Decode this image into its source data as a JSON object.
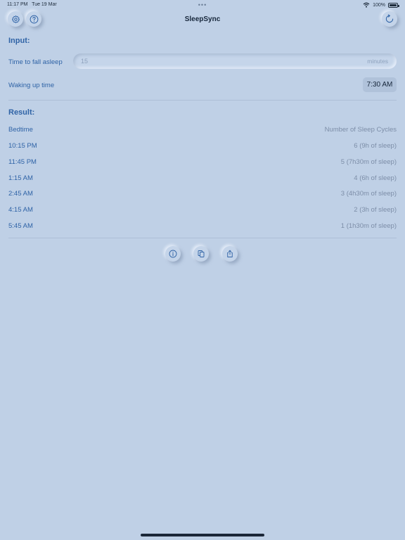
{
  "status_bar": {
    "time": "11:17 PM",
    "date": "Tue 19 Mar",
    "battery": "100%",
    "dots": "•••"
  },
  "header": {
    "title": "SleepSync"
  },
  "icons": {
    "settings": "gear-icon",
    "help": "question-icon",
    "reset": "refresh-icon",
    "info": "info-icon",
    "copy": "copy-icon",
    "share": "share-icon"
  },
  "input": {
    "section_title": "Input:",
    "fall_asleep_label": "Time to fall asleep",
    "fall_asleep_value": "15",
    "fall_asleep_unit": "minutes",
    "wake_label": "Waking up time",
    "wake_value": "7:30 AM"
  },
  "result": {
    "section_title": "Result:",
    "col_bedtime": "Bedtime",
    "col_cycles": "Number of Sleep Cycles",
    "rows": [
      {
        "bedtime": "10:15 PM",
        "cycles": "6 (9h of sleep)"
      },
      {
        "bedtime": "11:45 PM",
        "cycles": "5 (7h30m of sleep)"
      },
      {
        "bedtime": "1:15 AM",
        "cycles": "4 (6h of sleep)"
      },
      {
        "bedtime": "2:45 AM",
        "cycles": "3 (4h30m of sleep)"
      },
      {
        "bedtime": "4:15 AM",
        "cycles": "2 (3h of sleep)"
      },
      {
        "bedtime": "5:45 AM",
        "cycles": "1 (1h30m of sleep)"
      }
    ]
  },
  "colors": {
    "background": "#bfd0e6",
    "accent": "#2f63a6",
    "secondary_text": "#7d8ea8"
  }
}
